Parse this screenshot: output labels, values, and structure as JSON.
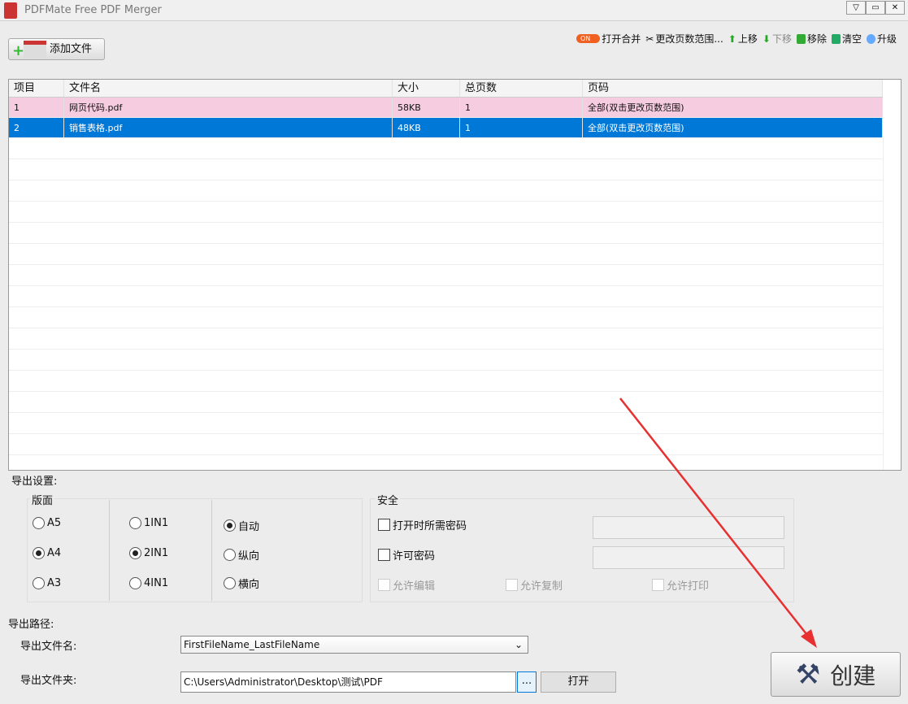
{
  "window": {
    "title": "PDFMate Free PDF Merger"
  },
  "toolbar": {
    "add_files": "添加文件",
    "toggle_on": "ON",
    "open_merge": "打开合并",
    "change_range": "更改页数范围...",
    "move_up": "上移",
    "move_down": "下移",
    "remove": "移除",
    "clear": "清空",
    "upgrade": "升级"
  },
  "table": {
    "headers": [
      "项目",
      "文件名",
      "大小",
      "总页数",
      "页码"
    ],
    "rows": [
      {
        "c": [
          "1",
          "网页代码.pdf",
          "58KB",
          "1",
          "全部(双击更改页数范围)"
        ]
      },
      {
        "c": [
          "2",
          "销售表格.pdf",
          "48KB",
          "1",
          "全部(双击更改页数范围)"
        ]
      }
    ]
  },
  "output": {
    "title": "导出设置:",
    "layout_label": "版面",
    "sizes": [
      "A5",
      "A4",
      "A3"
    ],
    "nup": [
      "1IN1",
      "2IN1",
      "4IN1"
    ],
    "orient": [
      "自动",
      "纵向",
      "横向"
    ],
    "security_label": "安全",
    "open_pwd": "打开时所需密码",
    "perm_pwd": "许可密码",
    "allow_edit": "允许编辑",
    "allow_copy": "允许复制",
    "allow_print": "允许打印"
  },
  "path": {
    "title": "导出路径:",
    "name_label": "导出文件名:",
    "name_value": "FirstFileName_LastFileName",
    "folder_label": "导出文件夹:",
    "folder_value": "C:\\Users\\Administrator\\Desktop\\测试\\PDF",
    "browse": "...",
    "open": "打开"
  },
  "create": "创建"
}
